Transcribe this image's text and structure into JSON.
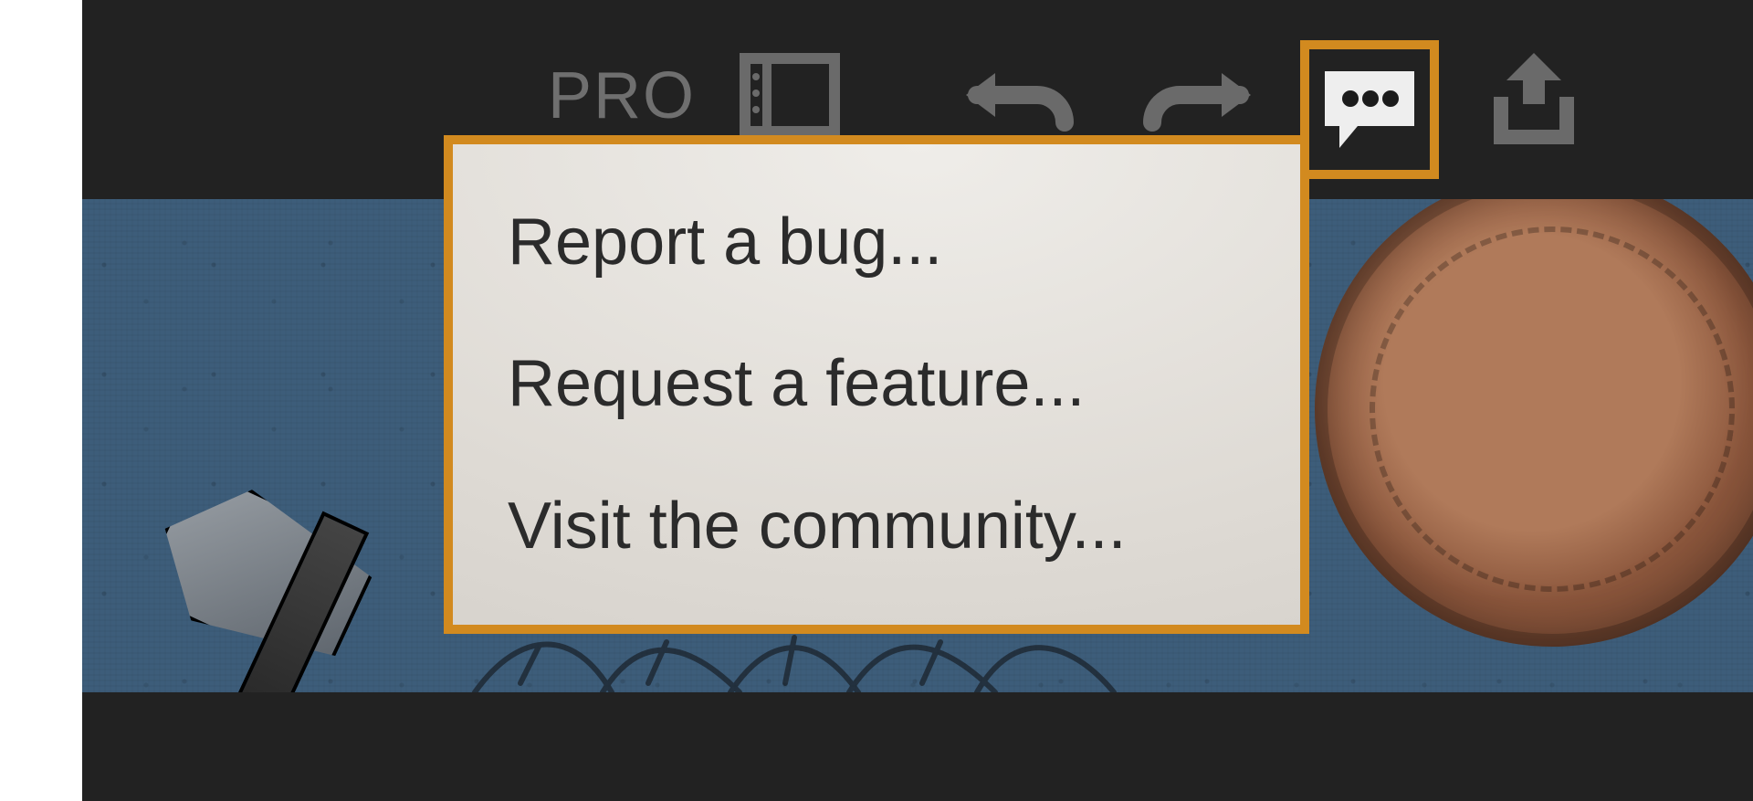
{
  "toolbar": {
    "pro_label": "PRO"
  },
  "feedback_menu": {
    "items": [
      {
        "label": "Report a bug..."
      },
      {
        "label": "Request a feature..."
      },
      {
        "label": "Visit the community..."
      }
    ]
  },
  "colors": {
    "highlight": "#d28a1f",
    "toolbar_bg": "#222222",
    "canvas_bg": "#3d5d7a"
  }
}
